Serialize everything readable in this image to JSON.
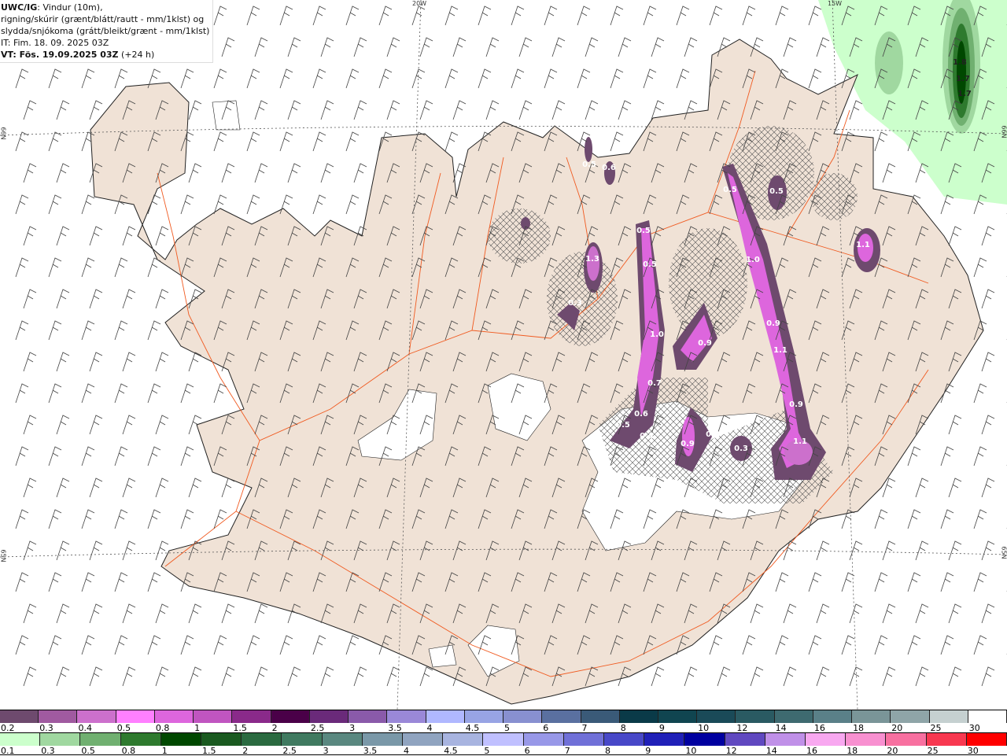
{
  "title": {
    "model": "UWC/IG",
    "line1": ": Vindur (10m),",
    "line2": "rigning/skúrir (grænt/blátt/rautt - mm/1klst) og",
    "line3": "slydda/snjókoma (grátt/bleikt/grænt - mm/1klst)",
    "issue_time": "IT: Fim. 18. 09. 2025 03Z",
    "valid_time": "VT: Fös. 19.09.2025 03Z",
    "lead": "(+24 h)"
  },
  "grid_labels": {
    "lon_20w": "20W",
    "lon_15w": "15W",
    "lat_66n_left": "66N",
    "lat_66n_right": "66N",
    "lat_65n_left": "65N",
    "lat_65n_right": "65N"
  },
  "colors": {
    "land": "#f0e2d6",
    "roads": "#f05a20",
    "hatch": "#555555"
  },
  "snow_labels": [
    "0.5",
    "0.6",
    "0.5",
    "0.5",
    "1.3",
    "0.3",
    "1.0",
    "0.7",
    "0.6",
    "0.5",
    "0.4",
    "0.9",
    "0.9",
    "0.3",
    "0.3",
    "0.5",
    "0.5",
    "1.0",
    "0.9",
    "1.1",
    "0.9",
    "1.1",
    "1.1"
  ],
  "rain_labels": [
    "1.8",
    "1.7",
    "1.7"
  ],
  "legend_snow": {
    "labels": [
      "0.2",
      "0.3",
      "0.4",
      "0.5",
      "0.8",
      "1",
      "1.5",
      "2",
      "2.5",
      "3",
      "3.5",
      "4",
      "4.5",
      "5",
      "6",
      "7",
      "8",
      "9",
      "10",
      "12",
      "14",
      "16",
      "18",
      "20",
      "25",
      "30"
    ],
    "colors": [
      "#6e4a6e",
      "#a05aa0",
      "#cc70cc",
      "#ff80ff",
      "#dd66dd",
      "#c055c0",
      "#8a2a8a",
      "#4a0048",
      "#6a2a7a",
      "#8a5aaa",
      "#9a88d8",
      "#b0b8ff",
      "#98a4e4",
      "#8890d0",
      "#5a70a0",
      "#3a5a78",
      "#0a3a48",
      "#104550",
      "#1a4a58",
      "#2a5a62",
      "#3e6a70",
      "#5a8088",
      "#7a9598",
      "#8fa5a8",
      "#c5d0d0",
      "#ffffff"
    ]
  },
  "legend_rain": {
    "labels": [
      "0.1",
      "0.3",
      "0.5",
      "0.8",
      "1",
      "1.5",
      "2",
      "2.5",
      "3",
      "3.5",
      "4",
      "4.5",
      "5",
      "6",
      "7",
      "8",
      "9",
      "10",
      "12",
      "14",
      "16",
      "18",
      "20",
      "25",
      "30"
    ],
    "colors": [
      "#ccffcc",
      "#a0d8a0",
      "#70b070",
      "#2e7a2e",
      "#004800",
      "#1a5a20",
      "#2a6a40",
      "#407a60",
      "#5a8880",
      "#7a98a8",
      "#90a4c0",
      "#a8b4e0",
      "#c0c0ff",
      "#9898e8",
      "#7070d8",
      "#4848c8",
      "#2020b8",
      "#0000a0",
      "#6048c0",
      "#c090e8",
      "#f8a8f0",
      "#f890d0",
      "#f870a0",
      "#f83850",
      "#ff0000"
    ]
  }
}
